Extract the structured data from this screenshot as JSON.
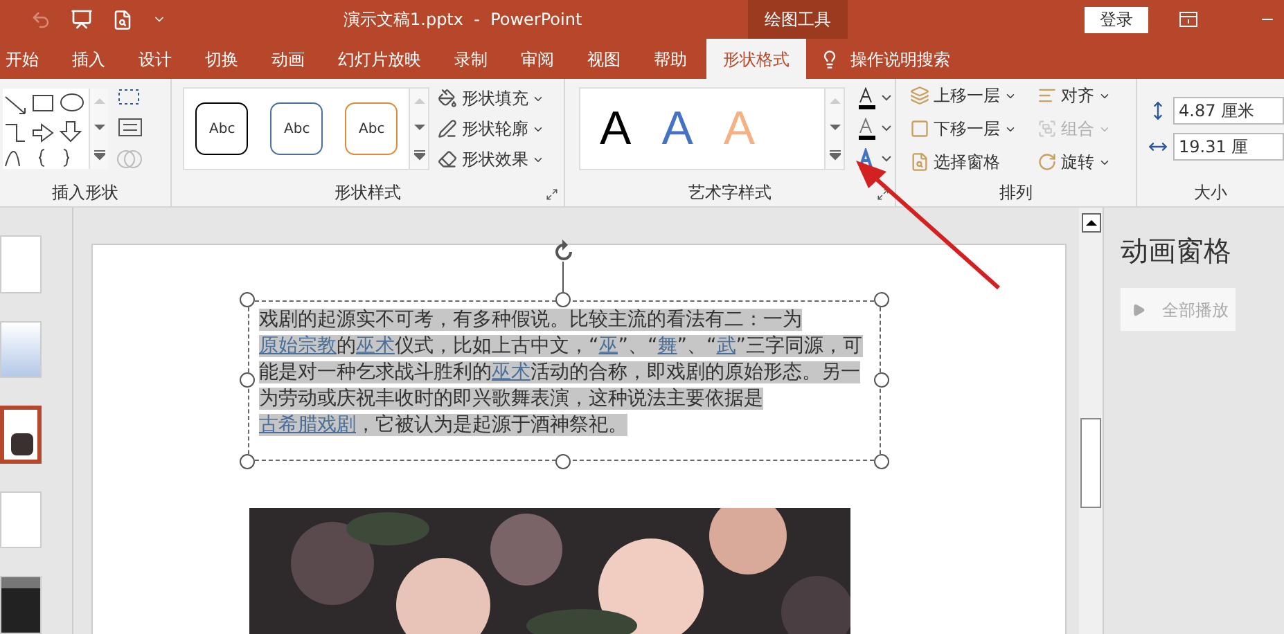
{
  "title_bar": {
    "title": "演示文稿1.pptx  -  PowerPoint",
    "context_label": "绘图工具",
    "sign_in": "登录"
  },
  "tabs": [
    {
      "label": "开始",
      "selected": false
    },
    {
      "label": "插入",
      "selected": false
    },
    {
      "label": "设计",
      "selected": false
    },
    {
      "label": "切换",
      "selected": false
    },
    {
      "label": "动画",
      "selected": false
    },
    {
      "label": "幻灯片放映",
      "selected": false
    },
    {
      "label": "录制",
      "selected": false
    },
    {
      "label": "审阅",
      "selected": false
    },
    {
      "label": "视图",
      "selected": false
    },
    {
      "label": "帮助",
      "selected": false
    },
    {
      "label": "形状格式",
      "selected": true
    }
  ],
  "tell_me": "操作说明搜索",
  "insert_shapes": {
    "label": "插入形状"
  },
  "shape_styles": {
    "label": "形状样式",
    "samples": [
      {
        "text": "Abc",
        "color": "#000000"
      },
      {
        "text": "Abc",
        "color": "#4a6f9a"
      },
      {
        "text": "Abc",
        "color": "#e08a3c"
      }
    ],
    "commands": [
      "形状填充",
      "形状轮廓",
      "形状效果"
    ]
  },
  "wordart_styles": {
    "label": "艺术字样式",
    "samples": [
      {
        "text": "A",
        "color": "#000000"
      },
      {
        "text": "A",
        "color": "#4472c4"
      },
      {
        "text": "A",
        "color": "#f4b183"
      }
    ]
  },
  "arrange": {
    "label": "排列",
    "commands": [
      {
        "label": "上移一层",
        "disabled": false
      },
      {
        "label": "对齐",
        "disabled": false
      },
      {
        "label": "下移一层",
        "disabled": false
      },
      {
        "label": "组合",
        "disabled": true
      },
      {
        "label": "选择窗格",
        "disabled": false
      },
      {
        "label": "旋转",
        "disabled": false
      }
    ]
  },
  "size": {
    "label": "大小",
    "height": "4.87 厘米",
    "width": "19.31 厘"
  },
  "slides": [
    {
      "kind": "plain",
      "selected": false
    },
    {
      "kind": "gradient",
      "selected": false
    },
    {
      "kind": "picture",
      "selected": true
    },
    {
      "kind": "plain",
      "selected": false
    },
    {
      "kind": "dark",
      "selected": false
    }
  ],
  "text_box": {
    "selected": true,
    "segments": [
      {
        "text": "戏剧的起源实不可考，有多种假说。比较主流的看法有二：一为",
        "link": false
      },
      {
        "text": "原始宗教",
        "link": true
      },
      {
        "text": "的",
        "link": false
      },
      {
        "text": "巫术",
        "link": true
      },
      {
        "text": "仪式，比如上古中文，“",
        "link": false
      },
      {
        "text": "巫",
        "link": true
      },
      {
        "text": "”、“",
        "link": false
      },
      {
        "text": "舞",
        "link": true
      },
      {
        "text": "”、“",
        "link": false
      },
      {
        "text": "武",
        "link": true
      },
      {
        "text": "”三字同源，可能是对一种乞求战斗胜利的",
        "link": false
      },
      {
        "text": "巫术",
        "link": true
      },
      {
        "text": "活动的合称，即戏剧的原始形态。另一为劳动或庆祝丰收时的即兴歌舞表演，这种说法主要依据是",
        "link": false
      },
      {
        "text": "古希腊戏剧",
        "link": true
      },
      {
        "text": "，它被认为是起源于酒神祭祀。",
        "link": false
      }
    ]
  },
  "animation_pane": {
    "title": "动画窗格",
    "play_all": {
      "label": "全部播放",
      "disabled": true
    }
  }
}
